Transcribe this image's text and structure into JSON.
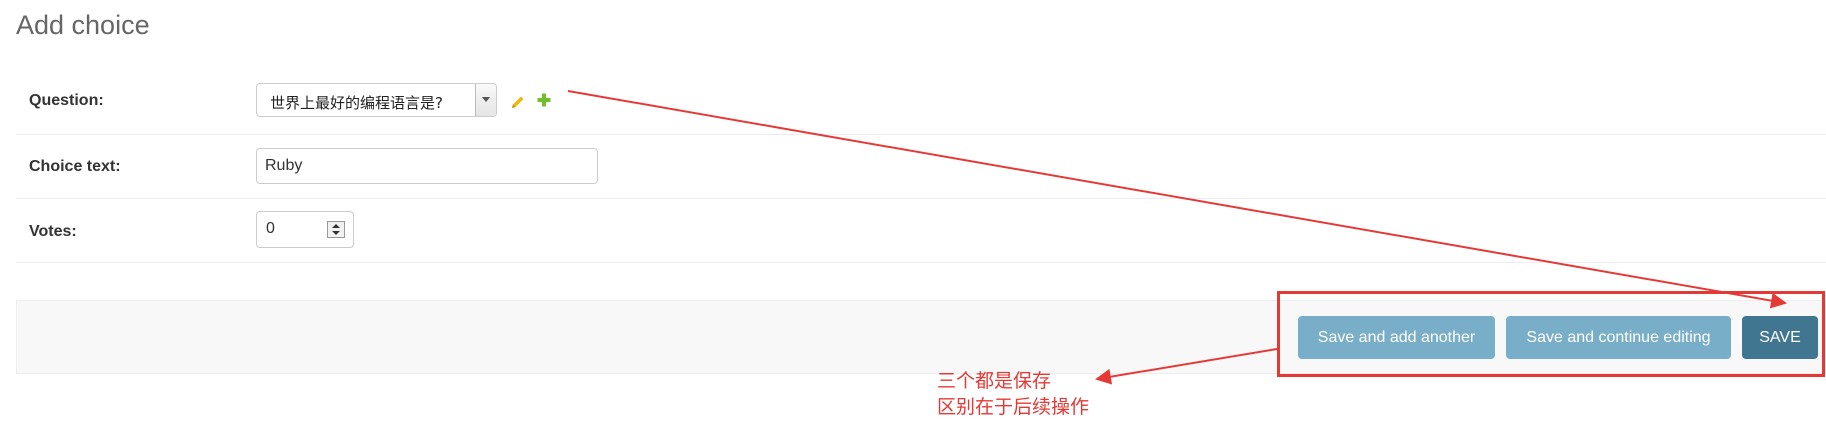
{
  "page": {
    "title": "Add choice"
  },
  "form": {
    "question": {
      "label": "Question:",
      "selected": "世界上最好的编程语言是?"
    },
    "choice_text": {
      "label": "Choice text:",
      "value": "Ruby"
    },
    "votes": {
      "label": "Votes:",
      "value": "0"
    }
  },
  "submit": {
    "save_add_label": "Save and add another",
    "save_continue_label": "Save and continue editing",
    "save_label": "SAVE"
  },
  "annotation": {
    "line1": "三个都是保存",
    "line2": "区别在于后续操作",
    "color": "#e53935"
  },
  "colors": {
    "button_light": "#79aec8",
    "button_dark": "#417690",
    "edit_icon": "#efb80b",
    "add_icon": "#70bf2b"
  }
}
